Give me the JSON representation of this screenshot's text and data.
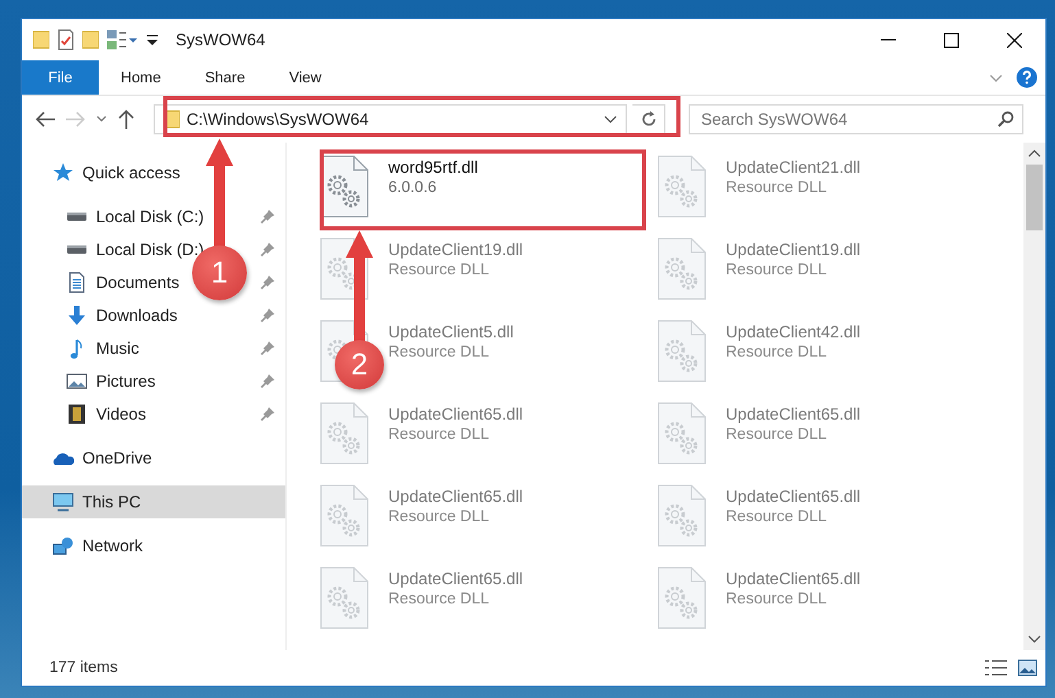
{
  "window": {
    "title": "SysWOW64"
  },
  "ribbon_tabs": [
    {
      "label": "File",
      "selected": true
    },
    {
      "label": "Home",
      "selected": false
    },
    {
      "label": "Share",
      "selected": false
    },
    {
      "label": "View",
      "selected": false
    }
  ],
  "address": {
    "path": "C:\\Windows\\SysWOW64"
  },
  "search": {
    "placeholder": "Search SysWOW64"
  },
  "sidebar": {
    "items": [
      {
        "label": "Quick access",
        "kind": "star",
        "pinned": false,
        "selected": false,
        "children": [
          {
            "label": "Local Disk (C:)",
            "kind": "disk",
            "pinned": true,
            "selected": false
          },
          {
            "label": "Local Disk (D:)",
            "kind": "disk",
            "pinned": true,
            "selected": false
          },
          {
            "label": "Documents",
            "kind": "doc",
            "pinned": true,
            "selected": false
          },
          {
            "label": "Downloads",
            "kind": "download",
            "pinned": true,
            "selected": false
          },
          {
            "label": "Music",
            "kind": "music",
            "pinned": true,
            "selected": false
          },
          {
            "label": "Pictures",
            "kind": "pictures",
            "pinned": true,
            "selected": false
          },
          {
            "label": "Videos",
            "kind": "videos",
            "pinned": true,
            "selected": false
          }
        ]
      },
      {
        "label": "OneDrive",
        "kind": "cloud",
        "pinned": false,
        "selected": false
      },
      {
        "label": "This PC",
        "kind": "pc",
        "pinned": false,
        "selected": true
      },
      {
        "label": "Network",
        "kind": "network",
        "pinned": false,
        "selected": false
      }
    ]
  },
  "files": [
    {
      "name": "word95rtf.dll",
      "detail": "6.0.0.6",
      "faded": false
    },
    {
      "name": "UpdateClient21.dll",
      "detail": "Resource DLL",
      "faded": true
    },
    {
      "name": "UpdateClient19.dll",
      "detail": "Resource DLL",
      "faded": true
    },
    {
      "name": "UpdateClient19.dll",
      "detail": "Resource DLL",
      "faded": true
    },
    {
      "name": "UpdateClient5.dll",
      "detail": "Resource DLL",
      "faded": true
    },
    {
      "name": "UpdateClient42.dll",
      "detail": "Resource DLL",
      "faded": true
    },
    {
      "name": "UpdateClient65.dll",
      "detail": "Resource DLL",
      "faded": true
    },
    {
      "name": "UpdateClient65.dll",
      "detail": "Resource DLL",
      "faded": true
    },
    {
      "name": "UpdateClient65.dll",
      "detail": "Resource DLL",
      "faded": true
    },
    {
      "name": "UpdateClient65.dll",
      "detail": "Resource DLL",
      "faded": true
    },
    {
      "name": "UpdateClient65.dll",
      "detail": "Resource DLL",
      "faded": true
    },
    {
      "name": "UpdateClient65.dll",
      "detail": "Resource DLL",
      "faded": true
    }
  ],
  "status_bar": {
    "count": "177 items"
  },
  "annotations": [
    {
      "number": "1"
    },
    {
      "number": "2"
    }
  ]
}
